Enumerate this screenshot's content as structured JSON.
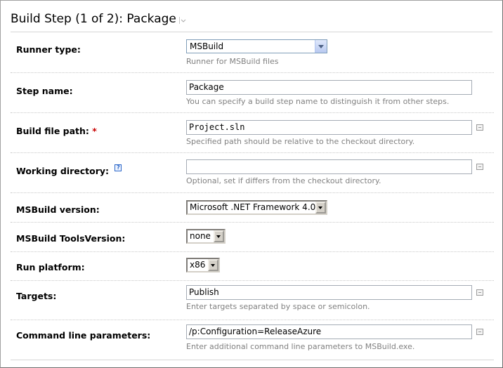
{
  "header": {
    "title": "Build Step (1 of 2): Package"
  },
  "fields": {
    "runner_type": {
      "label": "Runner type:",
      "value": "MSBuild",
      "note": "Runner for MSBuild files"
    },
    "step_name": {
      "label": "Step name:",
      "value": "Package",
      "note": "You can specify a build step name to distinguish it from other steps."
    },
    "build_file_path": {
      "label": "Build file path:",
      "required_mark": "*",
      "value": "Project.sln",
      "note": "Specified path should be relative to the checkout directory."
    },
    "working_directory": {
      "label": "Working directory:",
      "help_glyph": "?",
      "value": "",
      "note": "Optional, set if differs from the checkout directory."
    },
    "msbuild_version": {
      "label": "MSBuild version:",
      "value": "Microsoft .NET Framework 4.0"
    },
    "msbuild_tools_version": {
      "label": "MSBuild ToolsVersion:",
      "value": "none"
    },
    "run_platform": {
      "label": "Run platform:",
      "value": "x86"
    },
    "targets": {
      "label": "Targets:",
      "value": "Publish",
      "note": "Enter targets separated by space or semicolon."
    },
    "command_line_parameters": {
      "label": "Command line parameters:",
      "value": "/p:Configuration=ReleaseAzure",
      "note": "Enter additional command line parameters to MSBuild.exe."
    }
  }
}
